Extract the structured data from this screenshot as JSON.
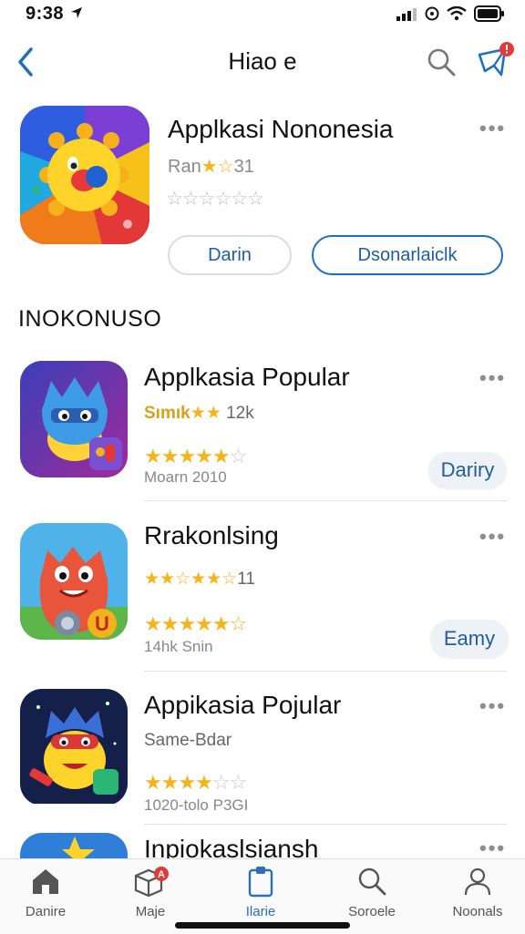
{
  "status_bar": {
    "time": "9:38"
  },
  "nav": {
    "title": "Hiao e"
  },
  "featured": {
    "title": "Applkasi Nononesia",
    "meta_prefix": "Ran",
    "meta_stars": "★☆",
    "meta_suffix": "31",
    "stars": "☆☆☆☆☆☆",
    "button_left": "Darin",
    "button_right": "Dsonarlaiclk",
    "icon": "sun-character-icon"
  },
  "section": {
    "title": "INOKONUSO"
  },
  "apps": [
    {
      "title": "Applkasia Popular",
      "sub_label": "Sımık",
      "sub_stars": "★★",
      "sub_count": "12k",
      "stars_filled": "★★★★★",
      "stars_empty": "☆",
      "foot": "Moarn 2010",
      "button": "Dariry",
      "icon": "blue-monster-icon"
    },
    {
      "title": "Rrakonlsing",
      "sub_stars": "★★☆★★☆",
      "sub_count": "11",
      "stars_filled": "★★★★★",
      "stars_empty": "☆",
      "foot": "14hk Snin",
      "button": "Eamy",
      "icon": "red-monster-icon"
    },
    {
      "title": "Appikasia Pojular",
      "sub_text": "Same-Bdar",
      "stars_filled": "★★★★",
      "stars_empty": "☆☆",
      "foot": "1020-tolo P3GI",
      "icon": "yellow-hero-icon"
    },
    {
      "title": "Inpiokaslsiansh",
      "icon": "star-character-icon"
    }
  ],
  "more_glyph": "•••",
  "tabs": [
    {
      "label": "Danire",
      "icon": "home-icon"
    },
    {
      "label": "Maje",
      "icon": "box-icon",
      "badge": "A"
    },
    {
      "label": "Ilarie",
      "icon": "clipboard-icon",
      "active": true
    },
    {
      "label": "Soroele",
      "icon": "search-icon"
    },
    {
      "label": "Noonals",
      "icon": "person-icon"
    }
  ],
  "colors": {
    "accent": "#1f6fbf",
    "star": "#f3b51b",
    "badge": "#e03a3a"
  }
}
